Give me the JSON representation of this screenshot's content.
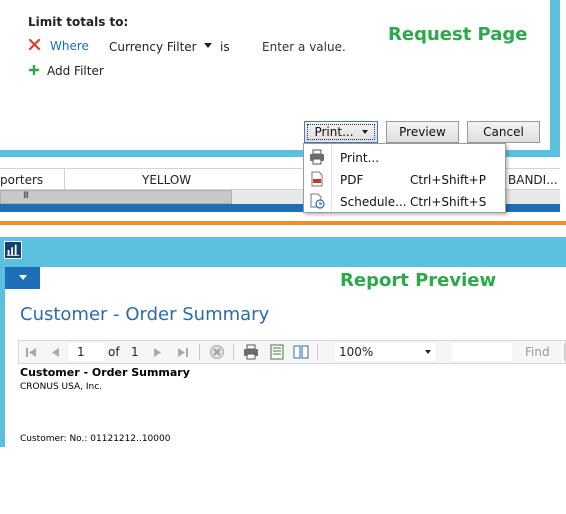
{
  "request_page": {
    "limit_label": "Limit totals to:",
    "filter": {
      "where_label": "Where",
      "field": "Currency Filter",
      "operator": "is",
      "value_placeholder": "Enter a value."
    },
    "add_filter_label": "Add Filter",
    "annotation": "Request Page",
    "buttons": {
      "print": "Print...",
      "preview": "Preview",
      "cancel": "Cancel"
    }
  },
  "background_grid": {
    "cells": [
      "porters",
      "YELLOW",
      "BANDI..."
    ],
    "scroll_grip": "III"
  },
  "print_menu": {
    "items": [
      {
        "label": "Print...",
        "shortcut": ""
      },
      {
        "label": "PDF",
        "shortcut": "Ctrl+Shift+P"
      },
      {
        "label": "Schedule...",
        "shortcut": "Ctrl+Shift+S"
      }
    ]
  },
  "preview": {
    "annotation": "Report Preview",
    "report_title": "Customer - Order Summary",
    "toolbar": {
      "page_current": "1",
      "page_of": "of",
      "page_total": "1",
      "zoom": "100%",
      "find_label": "Find"
    },
    "report": {
      "title": "Customer - Order Summary",
      "company": "CRONUS USA, Inc.",
      "filter_line": "Customer: No.: 01121212..10000"
    }
  },
  "colors": {
    "accent_blue": "#5bc0de",
    "dark_blue": "#1e6fb8",
    "annotation_green": "#2da84a",
    "separator_orange": "#f28c28",
    "remove_red": "#d9402c"
  }
}
